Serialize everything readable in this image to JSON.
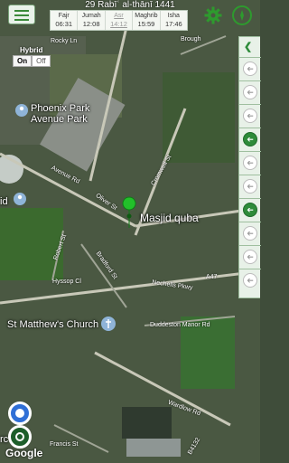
{
  "header": {
    "hijri_date": "29 Rabīʿ al-thānī 1441",
    "prayers": [
      {
        "name": "Fajr",
        "time": "06:31"
      },
      {
        "name": "Jumah",
        "time": "12:08"
      },
      {
        "name": "Asr",
        "time": "14:12"
      },
      {
        "name": "Maghrib",
        "time": "15:59"
      },
      {
        "name": "Isha",
        "time": "17:46"
      }
    ],
    "current_prayer": "Asr"
  },
  "map_layer": {
    "title": "Hybrid",
    "on_label": "On",
    "off_label": "Off",
    "selected": "On"
  },
  "map_labels": {
    "phoenix_park": "Phoenix Park\nAvenue Park",
    "masjid": "Masjid quba",
    "st_matthews": "St Matthew's Church",
    "partial_id": "id",
    "partial_rc": "rc"
  },
  "road_labels": {
    "hybrid_rd": "Rocky Ln",
    "brough": "Brough",
    "avenue_rd": "Avenue Rd",
    "oliver_st": "Oliver St",
    "cromwell_st": "Cromwell St",
    "robert_st": "Robert St",
    "bradford_st": "Bradford St",
    "hyssop_cl": "Hyssop Cl",
    "nechells_pkwy": "Nechells Pkwy",
    "a47": "A47",
    "duddeston": "Duddeston Manor Rd",
    "wardlow": "Wardlow Rd",
    "francis_st": "Francis St",
    "b4132": "B4132"
  },
  "attribution": "Google",
  "colors": {
    "accent": "#2e9a2e",
    "pin": "#22c02a"
  }
}
